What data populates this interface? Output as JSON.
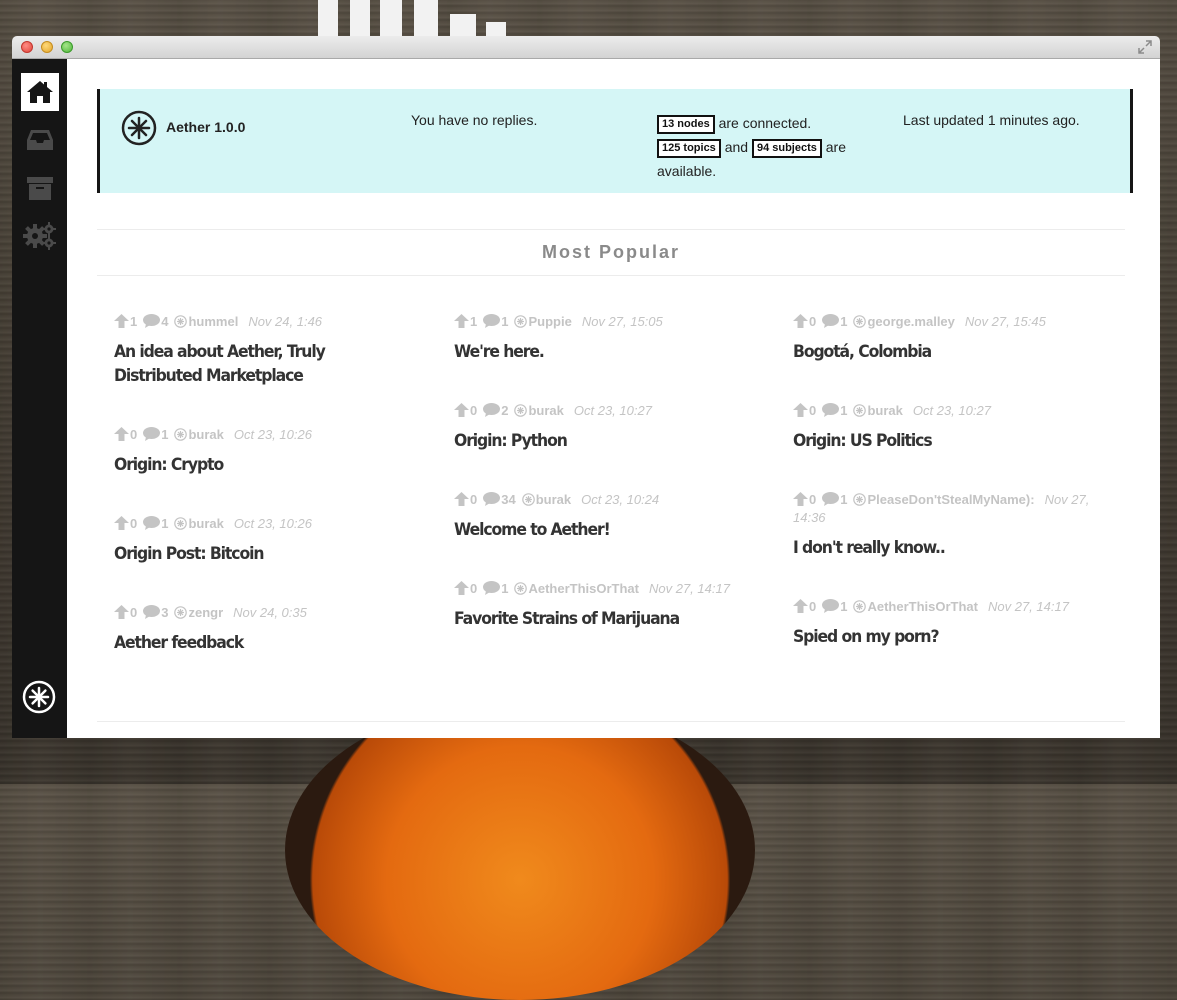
{
  "status_bar": {
    "version": "Aether 1.0.0",
    "replies": "You have no replies.",
    "nodes_badge": "13 nodes",
    "nodes_text": "are connected.",
    "topics_badge": "125 topics",
    "and_text": "and",
    "subjects_badge": "94 subjects",
    "are_text": "are",
    "available_text": "available.",
    "updated": "Last updated 1 minutes ago."
  },
  "section_title": "Most Popular",
  "sidebar": {
    "items": [
      {
        "name": "home-icon",
        "active": true
      },
      {
        "name": "inbox-icon",
        "active": false
      },
      {
        "name": "archive-icon",
        "active": false
      },
      {
        "name": "settings-gears-icon",
        "active": false
      }
    ]
  },
  "columns": [
    [
      {
        "votes": "1",
        "comments": "4",
        "user": "hummel",
        "date": "Nov 24, 1:46",
        "title": "An idea about Aether, Truly Distributed Marketplace"
      },
      {
        "votes": "0",
        "comments": "1",
        "user": "burak",
        "date": "Oct 23, 10:26",
        "title": "Origin: Crypto"
      },
      {
        "votes": "0",
        "comments": "1",
        "user": "burak",
        "date": "Oct 23, 10:26",
        "title": "Origin Post: Bitcoin"
      },
      {
        "votes": "0",
        "comments": "3",
        "user": "zengr",
        "date": "Nov 24, 0:35",
        "title": "Aether feedback"
      }
    ],
    [
      {
        "votes": "1",
        "comments": "1",
        "user": "Puppie",
        "date": "Nov 27, 15:05",
        "title": "We're here."
      },
      {
        "votes": "0",
        "comments": "2",
        "user": "burak",
        "date": "Oct 23, 10:27",
        "title": "Origin: Python"
      },
      {
        "votes": "0",
        "comments": "34",
        "user": "burak",
        "date": "Oct 23, 10:24",
        "title": "Welcome to Aether!"
      },
      {
        "votes": "0",
        "comments": "1",
        "user": "AetherThisOrThat",
        "date": "Nov 27, 14:17",
        "title": "Favorite Strains of Marijuana"
      }
    ],
    [
      {
        "votes": "0",
        "comments": "1",
        "user": "george.malley",
        "date": "Nov 27, 15:45",
        "title": "Bogotá, Colombia"
      },
      {
        "votes": "0",
        "comments": "1",
        "user": "burak",
        "date": "Oct 23, 10:27",
        "title": "Origin: US Politics"
      },
      {
        "votes": "0",
        "comments": "1",
        "user": "PleaseDon'tStealMyName):",
        "date": "Nov 27, 14:36",
        "title": "I don't really know.."
      },
      {
        "votes": "0",
        "comments": "1",
        "user": "AetherThisOrThat",
        "date": "Nov 27, 14:17",
        "title": "Spied on my porn?"
      }
    ]
  ]
}
